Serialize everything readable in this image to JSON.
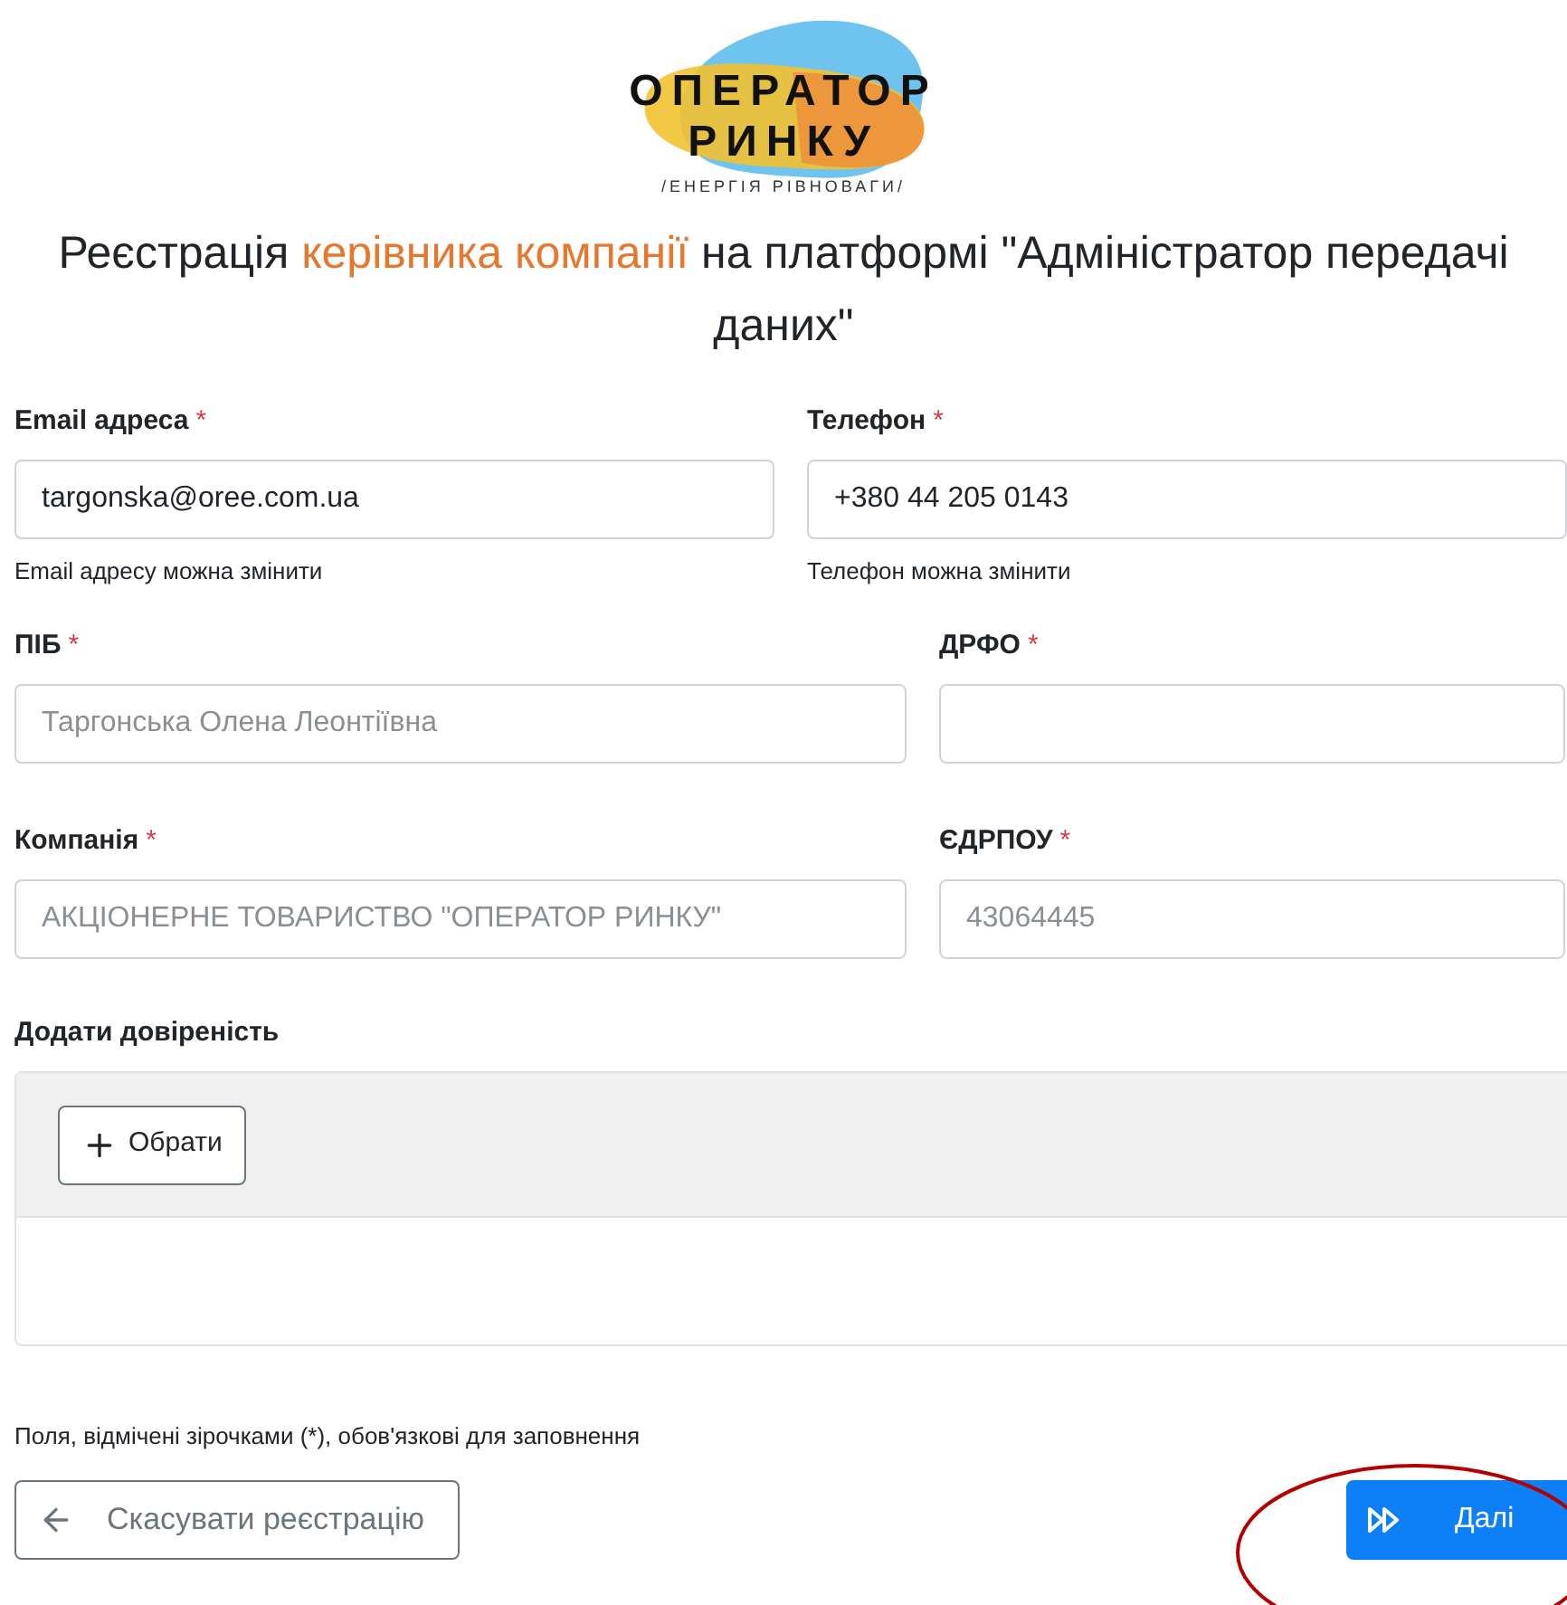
{
  "logo": {
    "line_1": "ОПЕРАТОР",
    "line_2": "РИНКУ",
    "tagline": "/ЕНЕРГІЯ РІВНОВАГИ/"
  },
  "title": [
    {
      "text": "Реєстрація ",
      "accent": false
    },
    {
      "text": "керівника компанії",
      "accent": true
    },
    {
      "text": " на платформі \"Адміністратор передачі даних\"",
      "accent": false
    }
  ],
  "rows": [
    {
      "fields": [
        {
          "label": "Email адреса",
          "required": true,
          "value": "targonska@oree.com.ua",
          "disabled": false,
          "hint": "Email адресу можна змінити"
        },
        {
          "label": "Телефон",
          "required": true,
          "value": "+380 44 205 0143",
          "disabled": false,
          "hint": "Телефон можна змінити"
        }
      ]
    },
    {
      "fields": [
        {
          "label": "ПІБ",
          "required": true,
          "value": "Таргонська Олена Леонтіївна",
          "disabled": true
        },
        {
          "label": "ДРФО",
          "required": true,
          "disabled": false
        }
      ]
    },
    {
      "fields": [
        {
          "label": "Компанія",
          "required": true,
          "value": "АКЦІОНЕРНЕ ТОВАРИСТВО \"ОПЕРАТОР РИНКУ\"",
          "disabled": true
        },
        {
          "label": "ЄДРПОУ",
          "required": true,
          "value": "43064445",
          "disabled": true
        }
      ]
    }
  ],
  "required_mark": "*",
  "upload": {
    "label": "Додати довіреність",
    "button": "Обрати"
  },
  "note": "Поля, відмічені зірочками (*), обов'язкові для заповнення",
  "cancel_button": "Скасувати реєстрацію",
  "next_button": "Далі"
}
